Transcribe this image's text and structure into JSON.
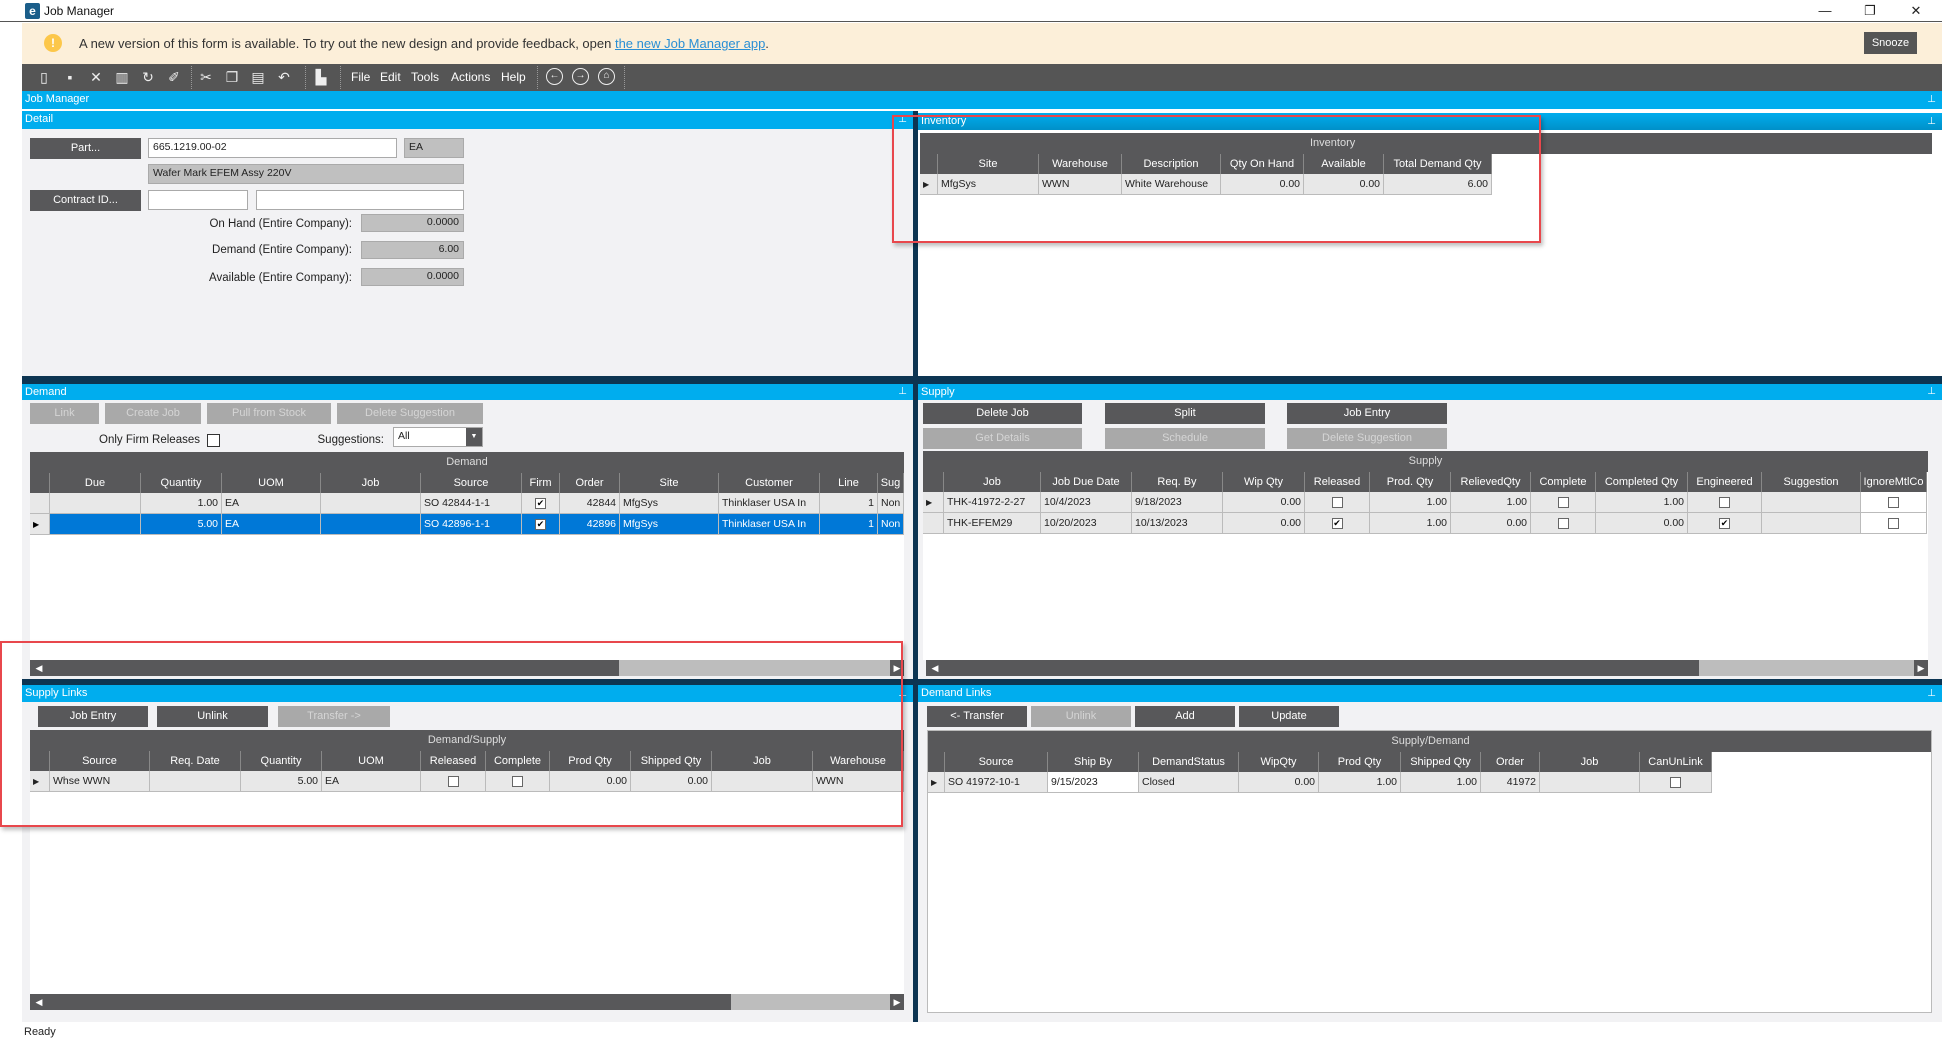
{
  "window": {
    "title": "Job Manager",
    "app_icon": "e",
    "minimize": "—",
    "restore": "❐",
    "close": "✕"
  },
  "banner": {
    "text": "A new version of this form is available. To try out the new design and provide feedback, open ",
    "link": "the new Job Manager app",
    "suffix": ".",
    "snooze": "Snooze",
    "icon": "!"
  },
  "toolbar": {
    "icons": [
      "new-icon",
      "save-icon",
      "delete-icon",
      "clear-icon",
      "refresh-icon",
      "undo-all-icon",
      "cut-icon",
      "copy-icon",
      "paste-icon",
      "undo-icon",
      "search-icon"
    ],
    "menus": [
      "File",
      "Edit",
      "Tools",
      "Actions",
      "Help"
    ],
    "nav": [
      "back-icon",
      "forward-icon",
      "home-icon"
    ]
  },
  "main_title": "Job Manager",
  "detail": {
    "title": "Detail",
    "part_button": "Part...",
    "part_value": "665.1219.00-02",
    "uom": "EA",
    "description": "Wafer Mark EFEM Assy 220V",
    "contract_button": "Contract ID...",
    "contract_value": "",
    "contract_desc": "",
    "on_hand_label": "On Hand (Entire Company):",
    "on_hand": "0.0000",
    "demand_label": "Demand (Entire Company):",
    "demand": "6.00",
    "available_label": "Available (Entire Company):",
    "available": "0.0000"
  },
  "inventory": {
    "title": "Inventory",
    "caption": "Inventory",
    "columns": [
      "",
      "Site",
      "Warehouse",
      "Description",
      "Qty On Hand",
      "Available",
      "Total Demand Qty"
    ],
    "rows": [
      [
        "",
        "MfgSys",
        "WWN",
        "White Warehouse",
        "0.00",
        "0.00",
        "6.00"
      ]
    ]
  },
  "demand": {
    "title": "Demand",
    "buttons": [
      "Link",
      "Create Job",
      "Pull from Stock",
      "Delete Suggestion"
    ],
    "only_firm_label": "Only Firm Releases",
    "only_firm": false,
    "suggestions_label": "Suggestions:",
    "suggestions_value": "All",
    "caption": "Demand",
    "columns": [
      "",
      "Due",
      "Quantity",
      "UOM",
      "Job",
      "Source",
      "Firm",
      "Order",
      "Site",
      "Customer",
      "Line",
      "Sug"
    ],
    "rows": [
      [
        "",
        "",
        "1.00",
        "EA",
        "",
        "SO 42844-1-1",
        true,
        "42844",
        "MfgSys",
        "Thinklaser USA In",
        "1",
        "Non"
      ],
      [
        "",
        "",
        "5.00",
        "EA",
        "",
        "SO 42896-1-1",
        true,
        "42896",
        "MfgSys",
        "Thinklaser USA In",
        "1",
        "Non"
      ]
    ],
    "selected_row": 1
  },
  "supply": {
    "title": "Supply",
    "buttons": [
      "Delete Job",
      "Split",
      "Job Entry"
    ],
    "buttons_disabled": [
      "Get Details",
      "Schedule",
      "Delete Suggestion"
    ],
    "caption": "Supply",
    "columns": [
      "",
      "Job",
      "Job Due Date",
      "Req. By",
      "Wip Qty",
      "Released",
      "Prod. Qty",
      "RelievedQty",
      "Complete",
      "Completed Qty",
      "Engineered",
      "Suggestion",
      "IgnoreMtlCo"
    ],
    "rows": [
      [
        "",
        "THK-41972-2-27",
        "10/4/2023",
        "9/18/2023",
        "0.00",
        false,
        "1.00",
        "1.00",
        false,
        "1.00",
        false,
        "",
        false
      ],
      [
        "",
        "THK-EFEM29",
        "10/20/2023",
        "10/13/2023",
        "0.00",
        true,
        "1.00",
        "0.00",
        false,
        "0.00",
        true,
        "",
        false
      ]
    ]
  },
  "supply_links": {
    "title": "Supply Links",
    "buttons": [
      "Job Entry",
      "Unlink"
    ],
    "button_disabled": "Transfer ->",
    "caption": "Demand/Supply",
    "columns": [
      "",
      "Source",
      "Req. Date",
      "Quantity",
      "UOM",
      "Released",
      "Complete",
      "Prod Qty",
      "Shipped Qty",
      "Job",
      "Warehouse"
    ],
    "rows": [
      [
        "",
        "Whse WWN",
        "",
        "5.00",
        "EA",
        false,
        false,
        "0.00",
        "0.00",
        "",
        "WWN"
      ]
    ]
  },
  "demand_links": {
    "title": "Demand Links",
    "buttons": [
      "<- Transfer",
      "Add",
      "Update"
    ],
    "button_disabled": "Unlink",
    "caption": "Supply/Demand",
    "columns": [
      "",
      "Source",
      "Ship By",
      "DemandStatus",
      "WipQty",
      "Prod Qty",
      "Shipped Qty",
      "Order",
      "Job",
      "CanUnLink"
    ],
    "rows": [
      [
        "",
        "SO 41972-10-1",
        "9/15/2023",
        "Closed",
        "0.00",
        "1.00",
        "1.00",
        "41972",
        "",
        false
      ]
    ]
  },
  "status": "Ready"
}
